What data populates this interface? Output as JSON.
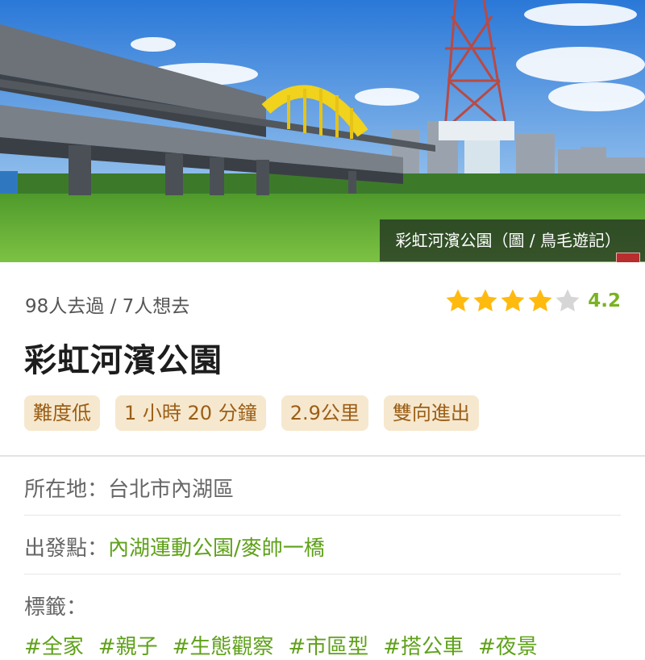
{
  "photo": {
    "caption": "彩虹河濱公園（圖 / 鳥毛遊記）"
  },
  "stats": {
    "visited_wanted": "98人去過 / 7人想去"
  },
  "rating": {
    "score": "4.2",
    "stars_filled": 4,
    "stars_total": 5,
    "filled_color": "#ffba10",
    "empty_color": "#d6d6d6"
  },
  "title": "彩虹河濱公園",
  "tags": [
    "難度低",
    "1 小時 20 分鐘",
    "2.9公里",
    "雙向進出"
  ],
  "location": {
    "label": "所在地：",
    "value": "台北市內湖區"
  },
  "start": {
    "label": "出發點：",
    "value": "內湖運動公園/麥帥一橋"
  },
  "labels": {
    "label": "標籤：",
    "hashtags": [
      "#全家",
      "#親子",
      "#生態觀察",
      "#市區型",
      "#搭公車",
      "#夜景"
    ]
  },
  "colors": {
    "link": "#5fa11a",
    "tag_bg": "#f6e8ce",
    "tag_text": "#9b5e17"
  }
}
